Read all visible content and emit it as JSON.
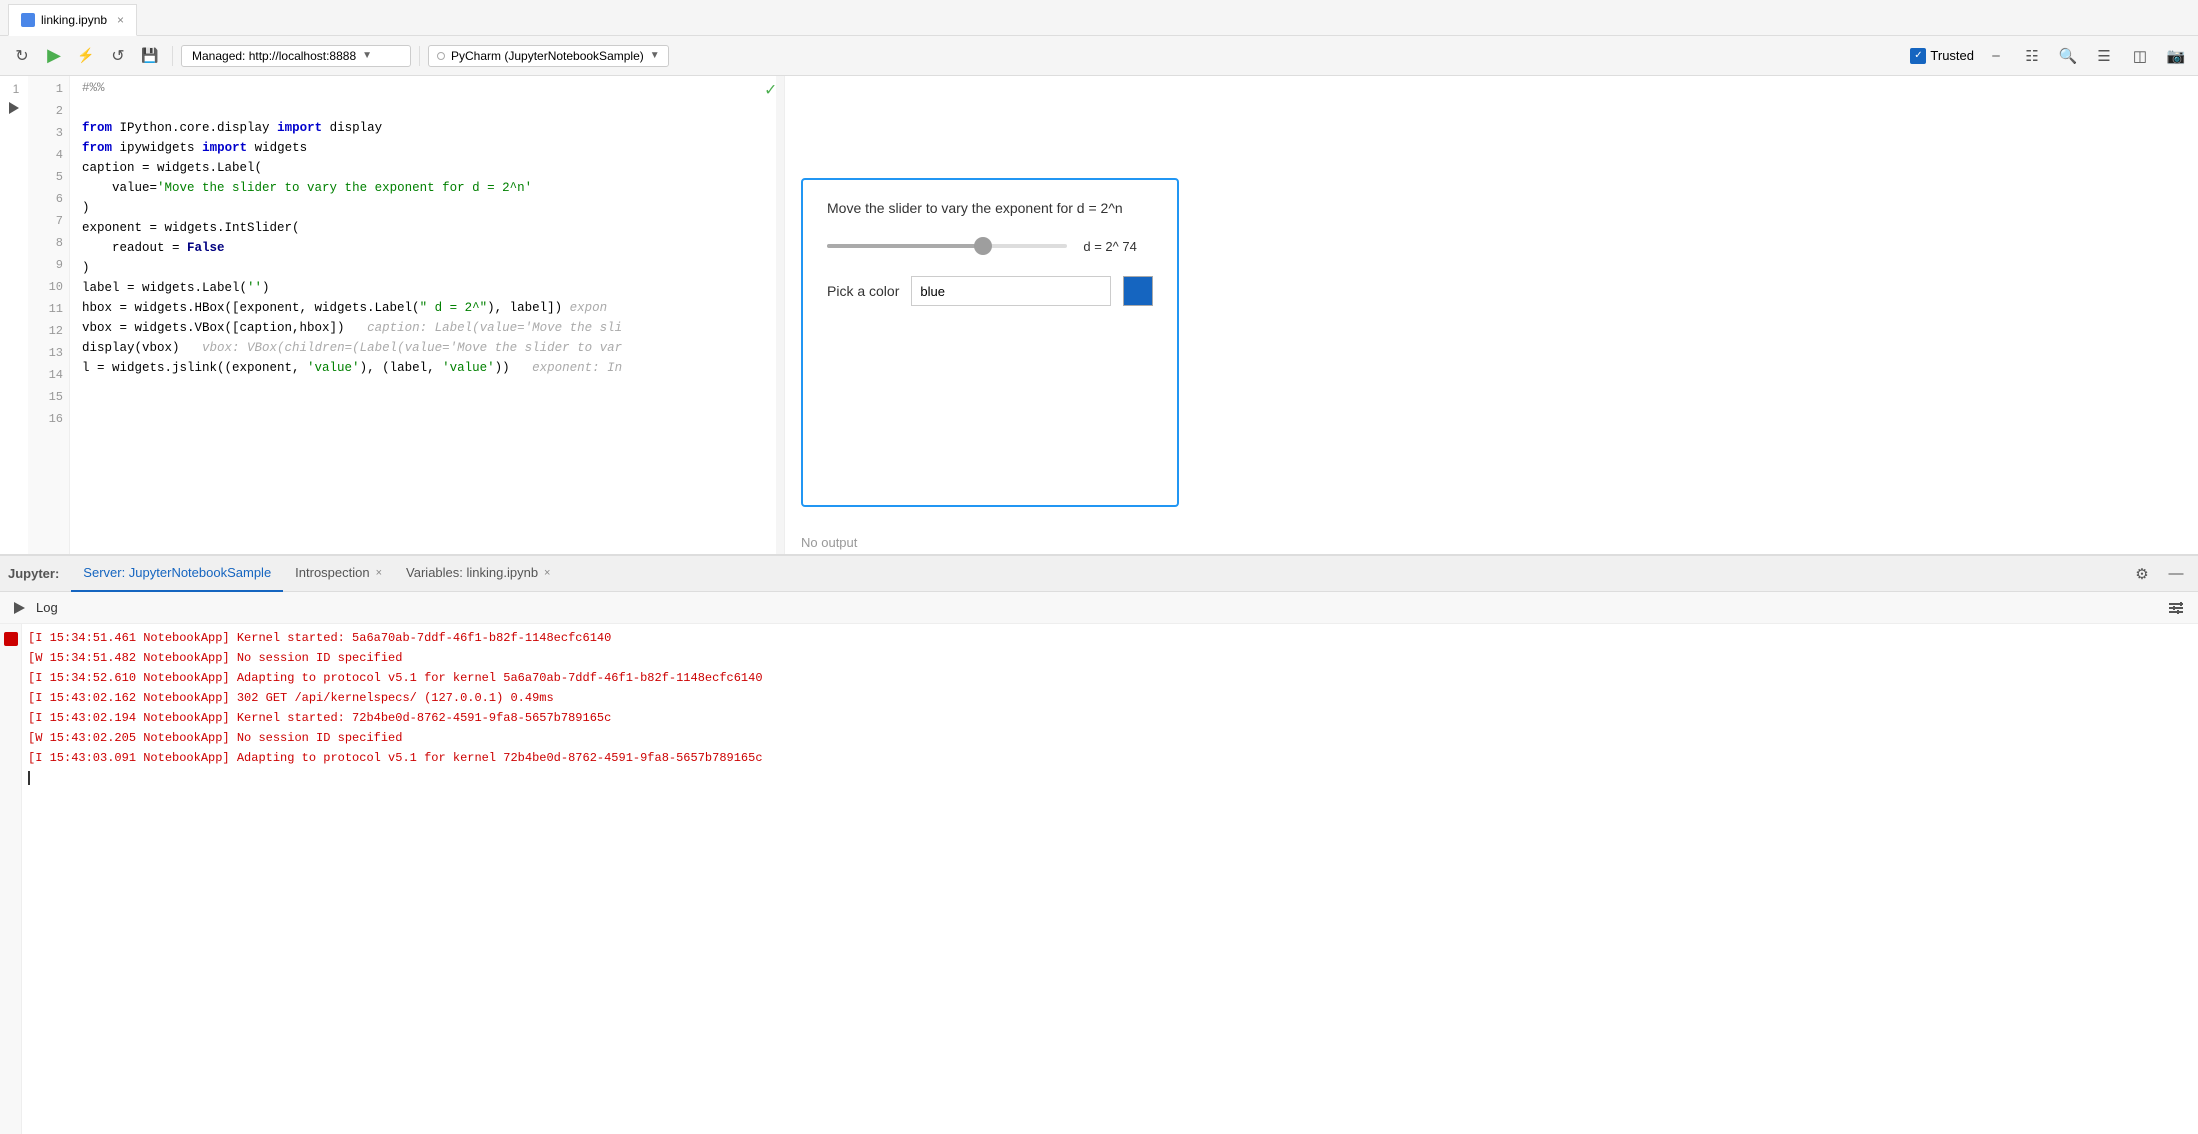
{
  "tab": {
    "icon": "notebook-icon",
    "label": "linking.ipynb",
    "close": "×"
  },
  "toolbar": {
    "managed_label": "Managed: http://localhost:8888",
    "kernel_label": "PyCharm (JupyterNotebookSample)",
    "trusted_label": "Trusted",
    "buttons": [
      "restart-icon",
      "run-icon",
      "interrupt-icon",
      "reload-icon",
      "save-icon"
    ]
  },
  "code": {
    "lines": [
      {
        "num": 1,
        "text": "#%%"
      },
      {
        "num": 2,
        "text": ""
      },
      {
        "num": 3,
        "text": "from IPython.core.display import display"
      },
      {
        "num": 4,
        "text": "from ipywidgets import widgets"
      },
      {
        "num": 5,
        "text": "caption = widgets.Label("
      },
      {
        "num": 6,
        "text": "    value='Move the slider to vary the exponent for d = 2^n'"
      },
      {
        "num": 7,
        "text": ")"
      },
      {
        "num": 8,
        "text": "exponent = widgets.IntSlider("
      },
      {
        "num": 9,
        "text": "    readout = False"
      },
      {
        "num": 10,
        "text": ")"
      },
      {
        "num": 11,
        "text": "label = widgets.Label('')"
      },
      {
        "num": 12,
        "text": "hbox = widgets.HBox([exponent, widgets.Label(\" d = 2^\"), label])  expon"
      },
      {
        "num": 13,
        "text": "vbox = widgets.VBox([caption,hbox])   caption: Label(value='Move the sli"
      },
      {
        "num": 14,
        "text": "display(vbox)   vbox: VBox(children=(Label(value='Move the slider to var"
      },
      {
        "num": 15,
        "text": "l = widgets.jslink((exponent, 'value'), (label, 'value'))   exponent: In"
      },
      {
        "num": 16,
        "text": ""
      }
    ]
  },
  "widget": {
    "label": "Move the slider to vary the exponent for d = 2^n",
    "slider_value": "d = 2^ 74",
    "color_label": "Pick a color",
    "color_input_value": "blue",
    "no_output": "No output"
  },
  "bottom_panel": {
    "jupyter_label": "Jupyter:",
    "tabs": [
      {
        "label": "Server: JupyterNotebookSample",
        "active": true,
        "closeable": false
      },
      {
        "label": "Introspection",
        "active": false,
        "closeable": true
      },
      {
        "label": "Variables: linking.ipynb",
        "active": false,
        "closeable": true
      }
    ],
    "log_label": "Log",
    "log_lines": [
      {
        "level": "I",
        "text": "[I 15:34:51.461 NotebookApp] Kernel started: 5a6a70ab-7ddf-46f1-b82f-1148ecfc6140"
      },
      {
        "level": "W",
        "text": "[W 15:34:51.482 NotebookApp] No session ID specified"
      },
      {
        "level": "I",
        "text": "[I 15:34:52.610 NotebookApp] Adapting to protocol v5.1 for kernel 5a6a70ab-7ddf-46f1-b82f-1148ecfc6140"
      },
      {
        "level": "I",
        "text": "[I 15:43:02.162 NotebookApp] 302 GET /api/kernelspecs/ (127.0.0.1) 0.49ms"
      },
      {
        "level": "I",
        "text": "[I 15:43:02.194 NotebookApp] Kernel started: 72b4be0d-8762-4591-9fa8-5657b789165c"
      },
      {
        "level": "W",
        "text": "[W 15:43:02.205 NotebookApp] No session ID specified"
      },
      {
        "level": "I",
        "text": "[I 15:43:03.091 NotebookApp] Adapting to protocol v5.1 for kernel 72b4be0d-8762-4591-9fa8-5657b789165c"
      }
    ]
  }
}
